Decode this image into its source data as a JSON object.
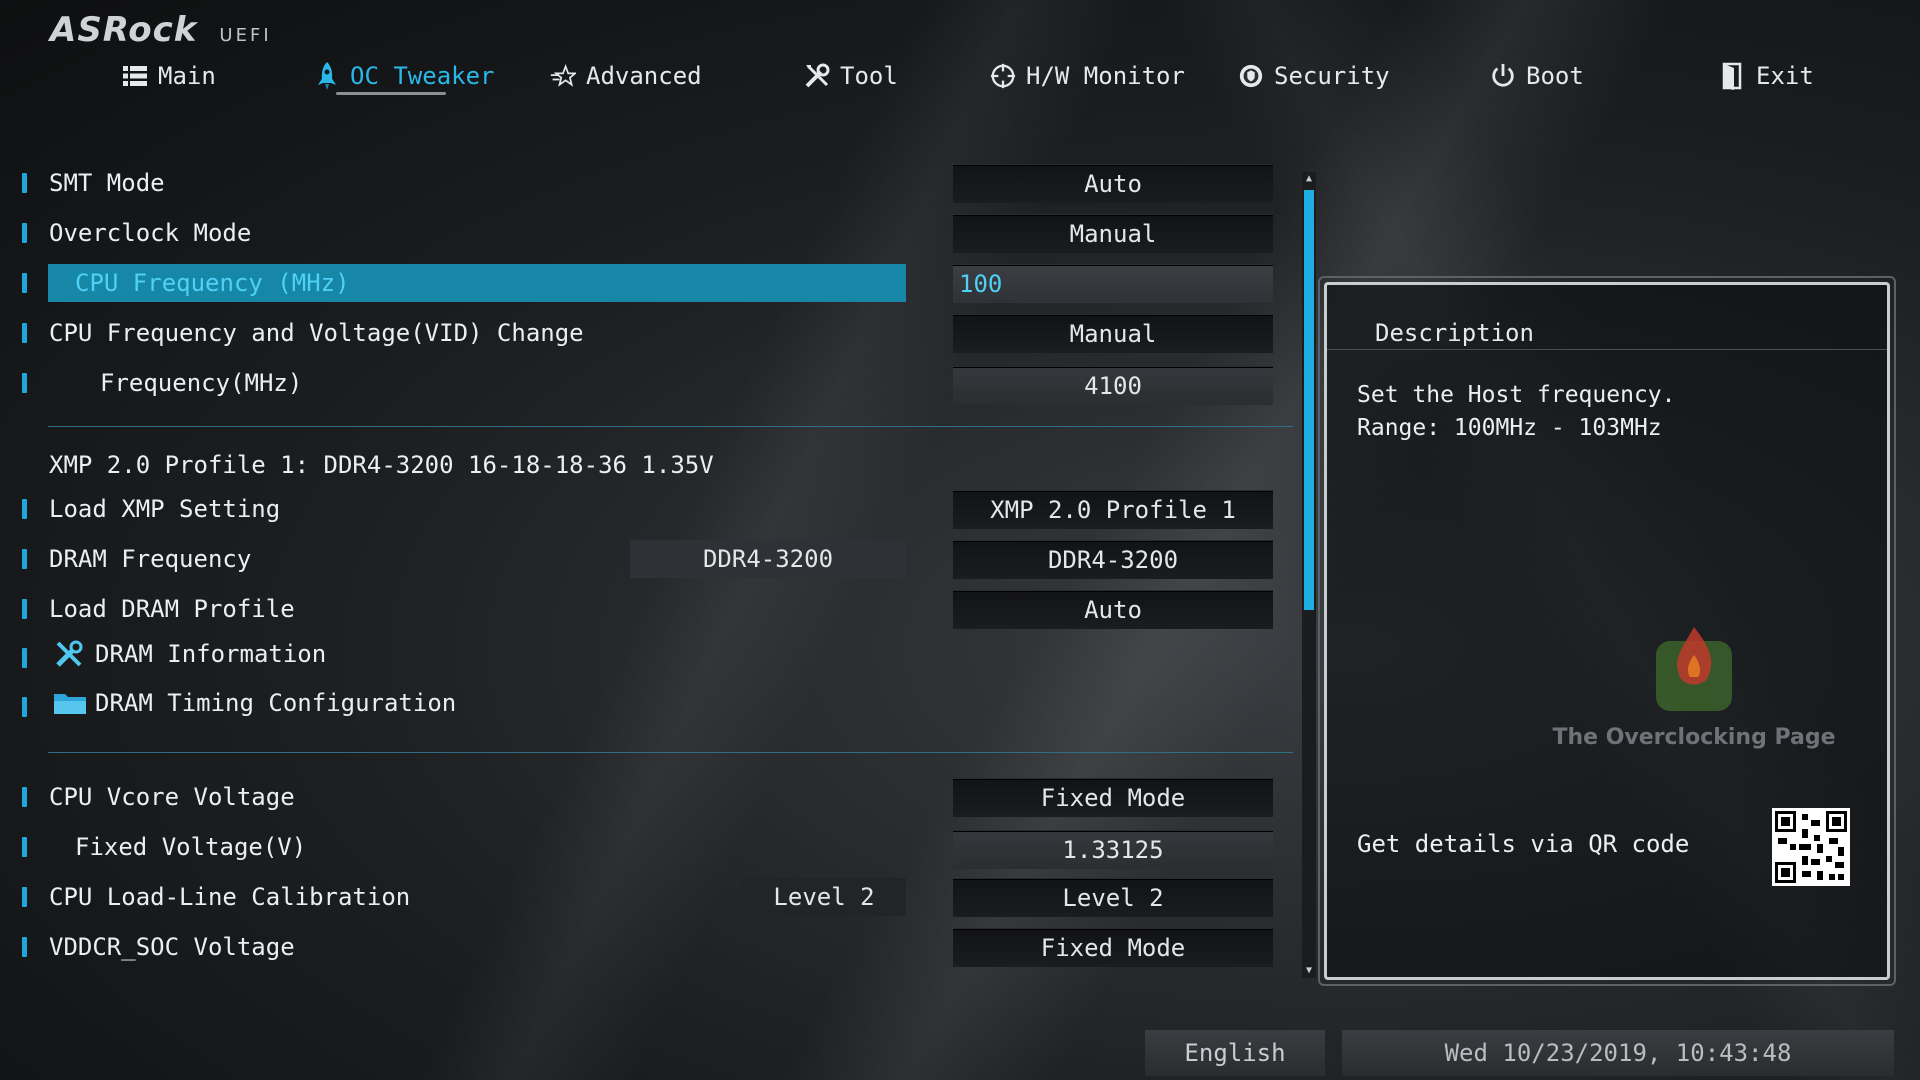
{
  "header": {
    "brand": "ASRock",
    "subtitle": "UEFI"
  },
  "tabs": [
    {
      "label": "Main",
      "icon": "list-icon"
    },
    {
      "label": "OC Tweaker",
      "icon": "rocket-icon",
      "active": true
    },
    {
      "label": "Advanced",
      "icon": "star-icon"
    },
    {
      "label": "Tool",
      "icon": "tools-icon"
    },
    {
      "label": "H/W Monitor",
      "icon": "crosshair-icon"
    },
    {
      "label": "Security",
      "icon": "shield-icon"
    },
    {
      "label": "Boot",
      "icon": "power-icon"
    },
    {
      "label": "Exit",
      "icon": "exit-door-icon"
    }
  ],
  "settings": {
    "smt_mode": {
      "label": "SMT Mode",
      "value": "Auto"
    },
    "overclock_mode": {
      "label": "Overclock Mode",
      "value": "Manual"
    },
    "cpu_frequency": {
      "label": "CPU Frequency (MHz)",
      "value": "100"
    },
    "cpu_freq_vid": {
      "label": "CPU Frequency and Voltage(VID) Change",
      "value": "Manual"
    },
    "frequency": {
      "label": "Frequency(MHz)",
      "value": "4100"
    },
    "xmp_profile_info": "XMP 2.0 Profile 1: DDR4-3200 16-18-18-36 1.35V",
    "load_xmp": {
      "label": "Load XMP Setting",
      "value": "XMP 2.0 Profile 1"
    },
    "dram_frequency": {
      "label": "DRAM Frequency",
      "current": "DDR4-3200",
      "value": "DDR4-3200"
    },
    "load_dram_profile": {
      "label": "Load DRAM Profile",
      "value": "Auto"
    },
    "dram_information": {
      "label": "DRAM Information"
    },
    "dram_timing": {
      "label": "DRAM Timing Configuration"
    },
    "cpu_vcore": {
      "label": "CPU Vcore Voltage",
      "value": "Fixed Mode"
    },
    "fixed_voltage": {
      "label": "Fixed Voltage(V)",
      "value": "1.33125"
    },
    "llc": {
      "label": "CPU Load-Line Calibration",
      "current": "Level 2",
      "value": "Level 2"
    },
    "vddcr_soc": {
      "label": "VDDCR_SOC Voltage",
      "value": "Fixed Mode"
    }
  },
  "description": {
    "title": "Description",
    "text": "Set the Host frequency.\nRange: 100MHz - 103MHz",
    "watermark": "The Overclocking Page",
    "qr_label": "Get details via QR code"
  },
  "footer": {
    "language": "English",
    "datetime": "Wed 10/23/2019, 10:43:48"
  },
  "colors": {
    "accent": "#1ea7dc",
    "selected_row": "#1787a7",
    "selected_text": "#4fd0f4"
  }
}
